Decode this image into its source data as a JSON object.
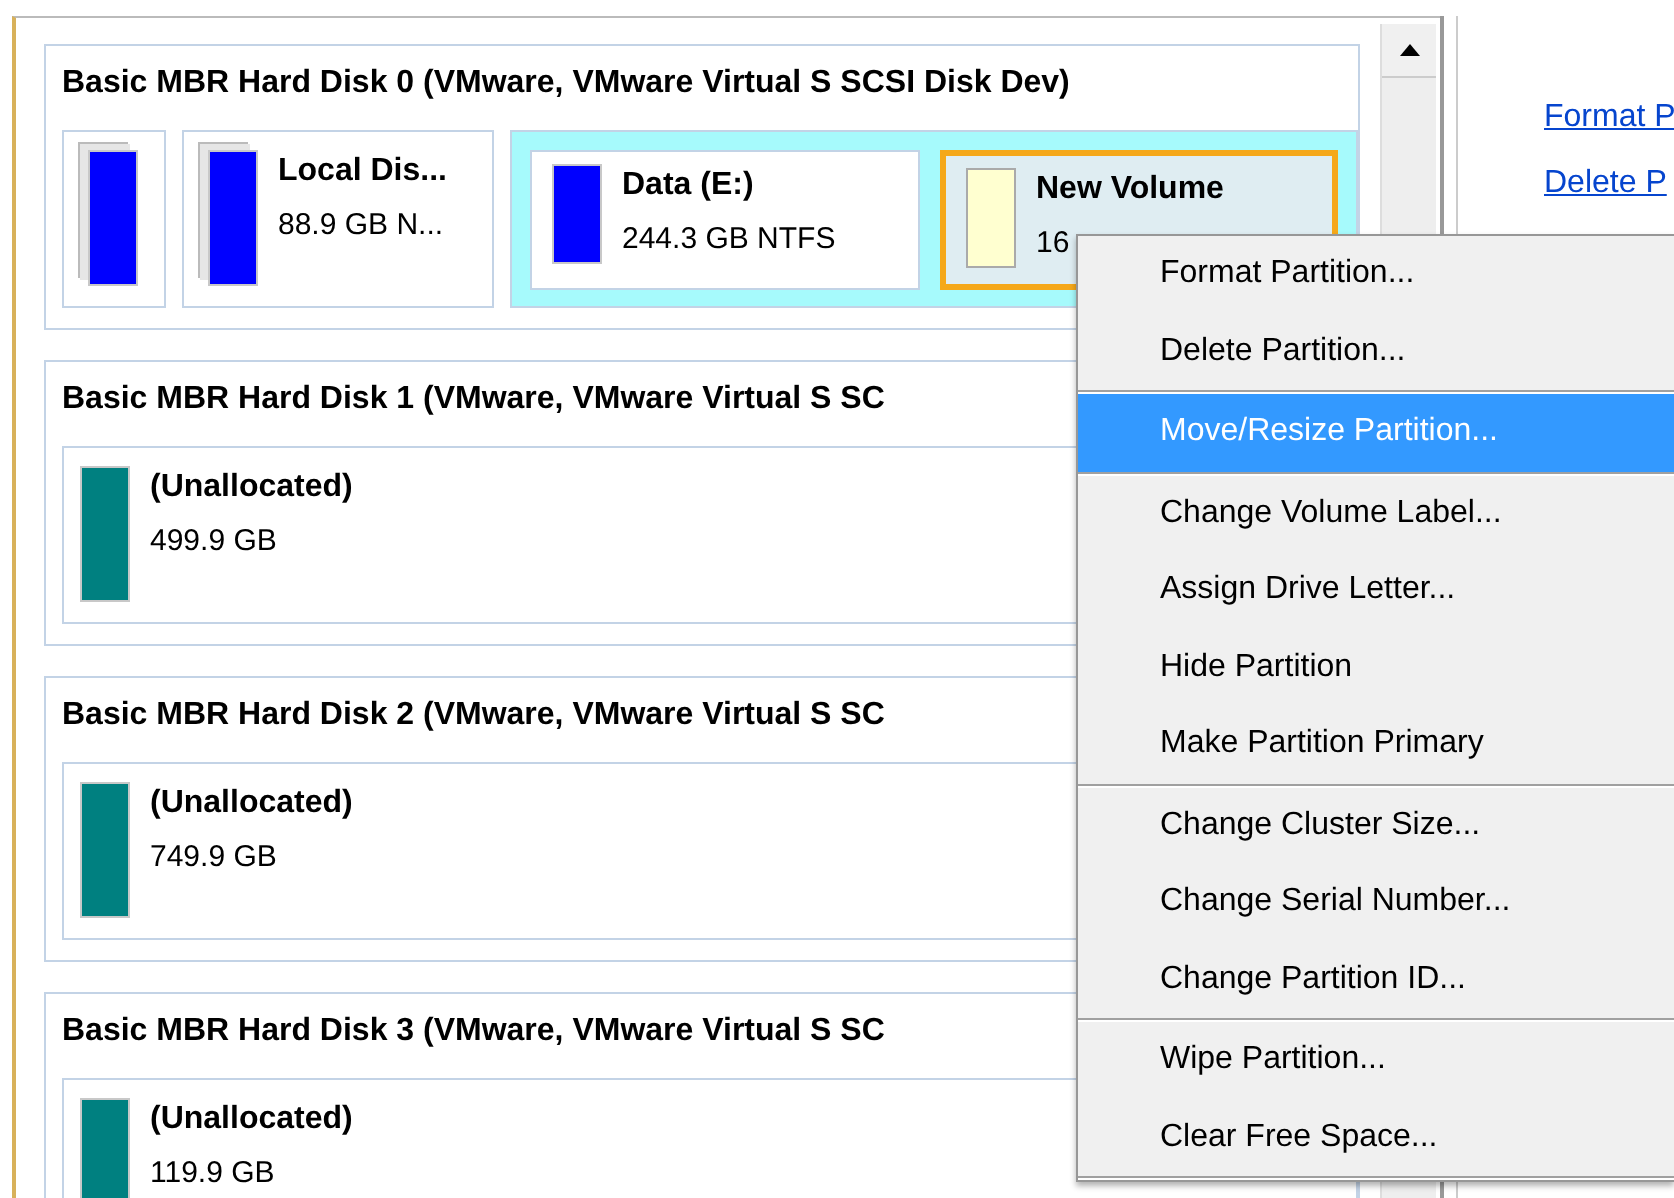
{
  "disks": [
    {
      "title": "Basic MBR Hard Disk 0 (VMware, VMware Virtual S SCSI Disk Dev)",
      "partitions": [
        {
          "kind": "primary",
          "color": "#0000ff",
          "selected": false
        },
        {
          "kind": "primary",
          "name": "Local Dis...",
          "info": "88.9 GB N...",
          "color": "#0000ff",
          "selected": false
        },
        {
          "kind": "extended",
          "children": [
            {
              "kind": "logical",
              "name": "Data (E:)",
              "info": "244.3 GB NTFS",
              "color": "#0000ff",
              "selected": false
            },
            {
              "kind": "logical",
              "name": "New Volume",
              "info": "16",
              "color": "#ffffd0",
              "selected": true
            }
          ]
        }
      ]
    },
    {
      "title": "Basic MBR Hard Disk 1 (VMware, VMware Virtual S SC",
      "partitions": [
        {
          "kind": "unallocated",
          "name": "(Unallocated)",
          "info": "499.9 GB",
          "color": "#008080",
          "selected": false
        }
      ]
    },
    {
      "title": "Basic MBR Hard Disk 2 (VMware, VMware Virtual S SC",
      "partitions": [
        {
          "kind": "unallocated",
          "name": "(Unallocated)",
          "info": "749.9 GB",
          "color": "#008080",
          "selected": false
        }
      ]
    },
    {
      "title": "Basic MBR Hard Disk 3 (VMware, VMware Virtual S SC",
      "partitions": [
        {
          "kind": "unallocated",
          "name": "(Unallocated)",
          "info": "119.9 GB",
          "color": "#008080",
          "selected": false
        }
      ]
    }
  ],
  "side_links": [
    "Format P",
    "Delete P"
  ],
  "context_menu": {
    "groups": [
      [
        {
          "label": "Format Partition...",
          "selected": false
        },
        {
          "label": "Delete Partition...",
          "selected": false
        }
      ],
      [
        {
          "label": "Move/Resize Partition...",
          "selected": true
        }
      ],
      [
        {
          "label": "Change Volume Label...",
          "selected": false
        },
        {
          "label": "Assign Drive Letter...",
          "selected": false
        },
        {
          "label": "Hide Partition",
          "selected": false
        },
        {
          "label": "Make Partition Primary",
          "selected": false
        }
      ],
      [
        {
          "label": "Change Cluster Size...",
          "selected": false
        },
        {
          "label": "Change Serial Number...",
          "selected": false
        },
        {
          "label": "Change Partition ID...",
          "selected": false
        }
      ],
      [
        {
          "label": "Wipe Partition...",
          "selected": false
        },
        {
          "label": "Clear Free Space...",
          "selected": false
        }
      ]
    ]
  }
}
